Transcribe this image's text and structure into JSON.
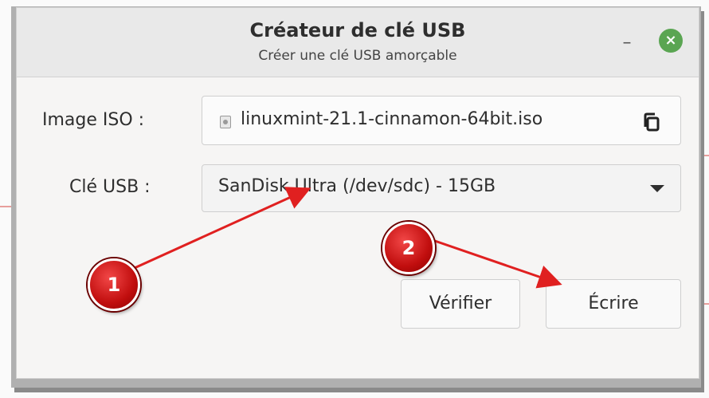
{
  "window": {
    "title": "Créateur de clé USB",
    "subtitle": "Créer une clé USB amorçable",
    "minimize_label": "–",
    "close_label": "×"
  },
  "iso": {
    "label": "Image ISO :",
    "value": "linuxmint-21.1-cinnamon-64bit.iso",
    "file_icon": "file-icon",
    "browse_icon": "copy-icon"
  },
  "usb": {
    "label": "Clé USB :",
    "selected": "SanDisk Ultra (/dev/sdc) - 15GB",
    "dropdown_icon": "chevron-down-icon"
  },
  "actions": {
    "verify_label": "Vérifier",
    "write_label": "Écrire"
  },
  "annotations": {
    "marker1_label": "1",
    "marker2_label": "2",
    "color": "#e02020"
  },
  "colors": {
    "close_button": "#5aa552",
    "annotation_red": "#d31515"
  }
}
